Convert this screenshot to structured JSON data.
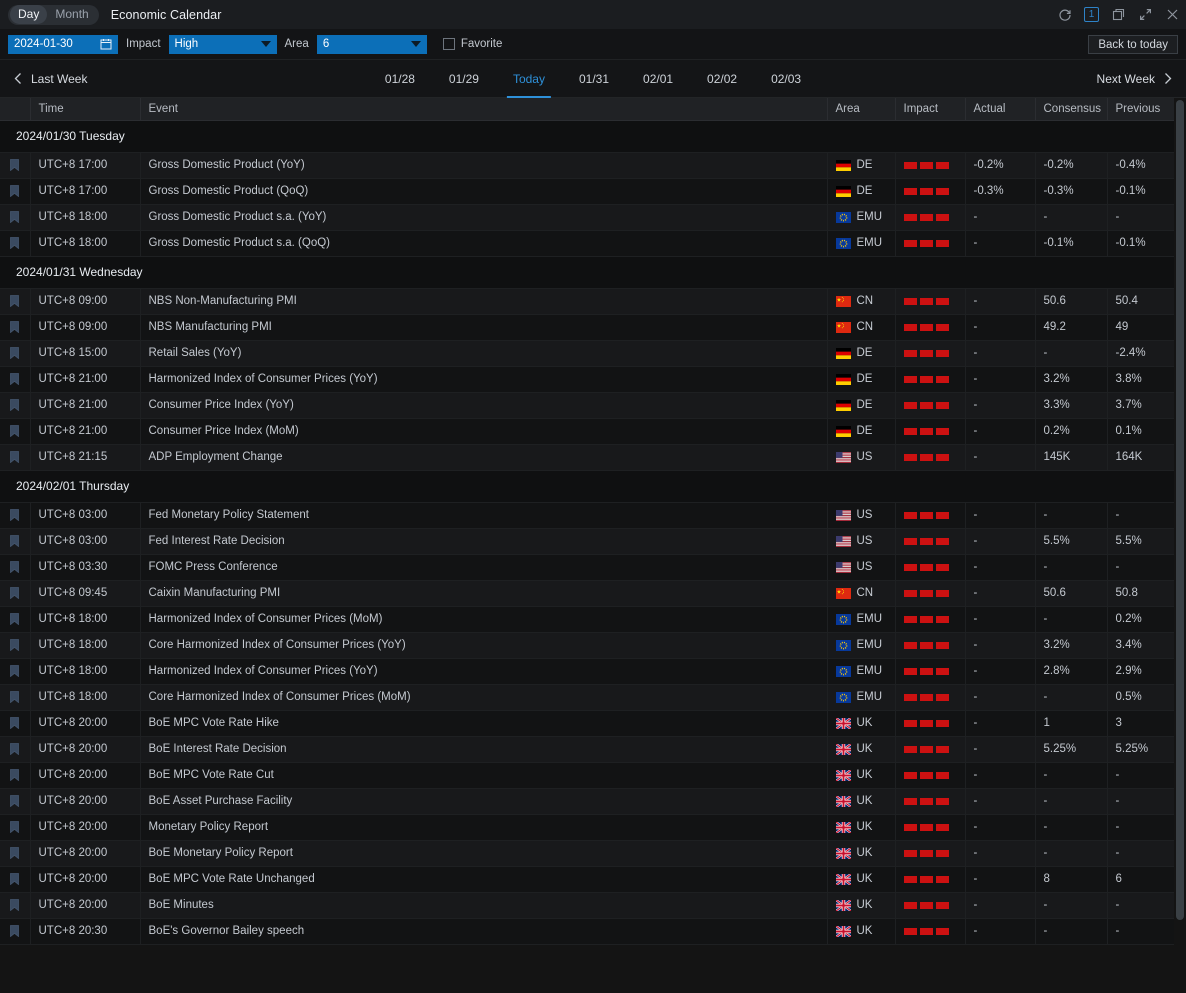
{
  "titlebar": {
    "view_day": "Day",
    "view_month": "Month",
    "active_view": "Day",
    "app_title": "Economic Calendar",
    "icons": {
      "refresh": "refresh-icon",
      "count_badge": "1",
      "restore": "restore-window-icon",
      "expand": "expand-icon",
      "close": "close-icon"
    }
  },
  "filterbar": {
    "date_value": "2024-01-30",
    "calendar_icon": "calendar-icon",
    "impact_label": "Impact",
    "impact_value": "High",
    "area_label": "Area",
    "area_value": "6",
    "favorite_label": "Favorite",
    "favorite_checked": false,
    "back_to_today": "Back to today"
  },
  "weeknav": {
    "last_week": "Last Week",
    "next_week": "Next Week",
    "days": [
      {
        "label": "01/28",
        "active": false
      },
      {
        "label": "01/29",
        "active": false
      },
      {
        "label": "Today",
        "active": true
      },
      {
        "label": "01/31",
        "active": false
      },
      {
        "label": "02/01",
        "active": false
      },
      {
        "label": "02/02",
        "active": false
      },
      {
        "label": "02/03",
        "active": false
      }
    ]
  },
  "table": {
    "columns": [
      "",
      "Time",
      "Event",
      "Area",
      "Impact",
      "Actual",
      "Consensus",
      "Previous"
    ],
    "groups": [
      {
        "title": "2024/01/30 Tuesday",
        "rows": [
          {
            "time": "UTC+8 17:00",
            "event": "Gross Domestic Product (YoY)",
            "area": "DE",
            "flag": "de",
            "impact": 3,
            "actual": "-0.2%",
            "consensus": "-0.2%",
            "previous": "-0.4%"
          },
          {
            "time": "UTC+8 17:00",
            "event": "Gross Domestic Product (QoQ)",
            "area": "DE",
            "flag": "de",
            "impact": 3,
            "actual": "-0.3%",
            "consensus": "-0.3%",
            "previous": "-0.1%"
          },
          {
            "time": "UTC+8 18:00",
            "event": "Gross Domestic Product s.a. (YoY)",
            "area": "EMU",
            "flag": "emu",
            "impact": 3,
            "actual": "-",
            "consensus": "-",
            "previous": "-"
          },
          {
            "time": "UTC+8 18:00",
            "event": "Gross Domestic Product s.a. (QoQ)",
            "area": "EMU",
            "flag": "emu",
            "impact": 3,
            "actual": "-",
            "consensus": "-0.1%",
            "previous": "-0.1%"
          }
        ]
      },
      {
        "title": "2024/01/31 Wednesday",
        "rows": [
          {
            "time": "UTC+8 09:00",
            "event": "NBS Non-Manufacturing PMI",
            "area": "CN",
            "flag": "cn",
            "impact": 3,
            "actual": "-",
            "consensus": "50.6",
            "previous": "50.4"
          },
          {
            "time": "UTC+8 09:00",
            "event": "NBS Manufacturing PMI",
            "area": "CN",
            "flag": "cn",
            "impact": 3,
            "actual": "-",
            "consensus": "49.2",
            "previous": "49"
          },
          {
            "time": "UTC+8 15:00",
            "event": "Retail Sales (YoY)",
            "area": "DE",
            "flag": "de",
            "impact": 3,
            "actual": "-",
            "consensus": "-",
            "previous": "-2.4%"
          },
          {
            "time": "UTC+8 21:00",
            "event": "Harmonized Index of Consumer Prices (YoY)",
            "area": "DE",
            "flag": "de",
            "impact": 3,
            "actual": "-",
            "consensus": "3.2%",
            "previous": "3.8%"
          },
          {
            "time": "UTC+8 21:00",
            "event": "Consumer Price Index (YoY)",
            "area": "DE",
            "flag": "de",
            "impact": 3,
            "actual": "-",
            "consensus": "3.3%",
            "previous": "3.7%"
          },
          {
            "time": "UTC+8 21:00",
            "event": "Consumer Price Index (MoM)",
            "area": "DE",
            "flag": "de",
            "impact": 3,
            "actual": "-",
            "consensus": "0.2%",
            "previous": "0.1%"
          },
          {
            "time": "UTC+8 21:15",
            "event": "ADP Employment Change",
            "area": "US",
            "flag": "us",
            "impact": 3,
            "actual": "-",
            "consensus": "145K",
            "previous": "164K"
          }
        ]
      },
      {
        "title": "2024/02/01 Thursday",
        "rows": [
          {
            "time": "UTC+8 03:00",
            "event": "Fed Monetary Policy Statement",
            "area": "US",
            "flag": "us",
            "impact": 3,
            "actual": "-",
            "consensus": "-",
            "previous": "-"
          },
          {
            "time": "UTC+8 03:00",
            "event": "Fed Interest Rate Decision",
            "area": "US",
            "flag": "us",
            "impact": 3,
            "actual": "-",
            "consensus": "5.5%",
            "previous": "5.5%"
          },
          {
            "time": "UTC+8 03:30",
            "event": "FOMC Press Conference",
            "area": "US",
            "flag": "us",
            "impact": 3,
            "actual": "-",
            "consensus": "-",
            "previous": "-"
          },
          {
            "time": "UTC+8 09:45",
            "event": "Caixin Manufacturing PMI",
            "area": "CN",
            "flag": "cn",
            "impact": 3,
            "actual": "-",
            "consensus": "50.6",
            "previous": "50.8"
          },
          {
            "time": "UTC+8 18:00",
            "event": "Harmonized Index of Consumer Prices (MoM)",
            "area": "EMU",
            "flag": "emu",
            "impact": 3,
            "actual": "-",
            "consensus": "-",
            "previous": "0.2%"
          },
          {
            "time": "UTC+8 18:00",
            "event": "Core Harmonized Index of Consumer Prices (YoY)",
            "area": "EMU",
            "flag": "emu",
            "impact": 3,
            "actual": "-",
            "consensus": "3.2%",
            "previous": "3.4%"
          },
          {
            "time": "UTC+8 18:00",
            "event": "Harmonized Index of Consumer Prices (YoY)",
            "area": "EMU",
            "flag": "emu",
            "impact": 3,
            "actual": "-",
            "consensus": "2.8%",
            "previous": "2.9%"
          },
          {
            "time": "UTC+8 18:00",
            "event": "Core Harmonized Index of Consumer Prices (MoM)",
            "area": "EMU",
            "flag": "emu",
            "impact": 3,
            "actual": "-",
            "consensus": "-",
            "previous": "0.5%"
          },
          {
            "time": "UTC+8 20:00",
            "event": "BoE MPC Vote Rate Hike",
            "area": "UK",
            "flag": "uk",
            "impact": 3,
            "actual": "-",
            "consensus": "1",
            "previous": "3"
          },
          {
            "time": "UTC+8 20:00",
            "event": "BoE Interest Rate Decision",
            "area": "UK",
            "flag": "uk",
            "impact": 3,
            "actual": "-",
            "consensus": "5.25%",
            "previous": "5.25%"
          },
          {
            "time": "UTC+8 20:00",
            "event": "BoE MPC Vote Rate Cut",
            "area": "UK",
            "flag": "uk",
            "impact": 3,
            "actual": "-",
            "consensus": "-",
            "previous": "-"
          },
          {
            "time": "UTC+8 20:00",
            "event": "BoE Asset Purchase Facility",
            "area": "UK",
            "flag": "uk",
            "impact": 3,
            "actual": "-",
            "consensus": "-",
            "previous": "-"
          },
          {
            "time": "UTC+8 20:00",
            "event": "Monetary Policy Report",
            "area": "UK",
            "flag": "uk",
            "impact": 3,
            "actual": "-",
            "consensus": "-",
            "previous": "-"
          },
          {
            "time": "UTC+8 20:00",
            "event": "BoE Monetary Policy Report",
            "area": "UK",
            "flag": "uk",
            "impact": 3,
            "actual": "-",
            "consensus": "-",
            "previous": "-"
          },
          {
            "time": "UTC+8 20:00",
            "event": "BoE MPC Vote Rate Unchanged",
            "area": "UK",
            "flag": "uk",
            "impact": 3,
            "actual": "-",
            "consensus": "8",
            "previous": "6"
          },
          {
            "time": "UTC+8 20:00",
            "event": "BoE Minutes",
            "area": "UK",
            "flag": "uk",
            "impact": 3,
            "actual": "-",
            "consensus": "-",
            "previous": "-"
          },
          {
            "time": "UTC+8 20:30",
            "event": "BoE's Governor Bailey speech",
            "area": "UK",
            "flag": "uk",
            "impact": 3,
            "actual": "-",
            "consensus": "-",
            "previous": "-"
          }
        ]
      }
    ]
  },
  "colors": {
    "accent": "#0c6fb8",
    "active_tab": "#2e90d9",
    "impact_bar": "#cc1111"
  }
}
